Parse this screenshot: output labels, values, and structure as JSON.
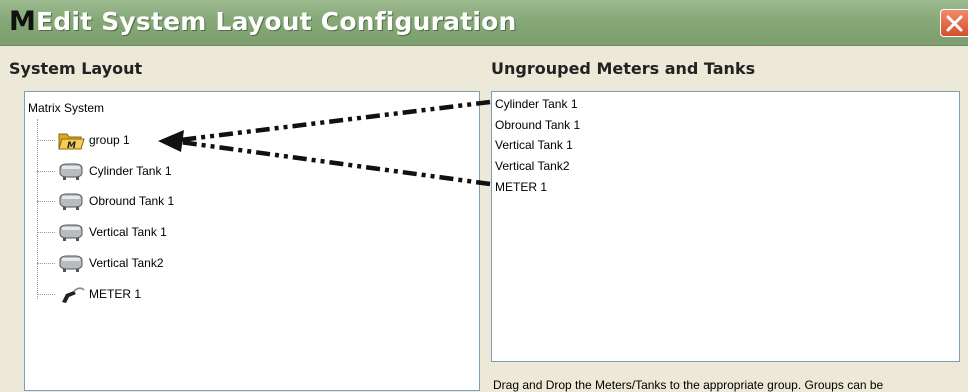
{
  "window": {
    "logo_letter": "M",
    "title": "Edit System Layout Configuration",
    "close_glyph": "close-icon"
  },
  "left_section": {
    "heading": "System Layout",
    "root_label": "Matrix System",
    "items": [
      {
        "label": "group 1",
        "icon": "group-folder-icon"
      },
      {
        "label": "Cylinder Tank 1",
        "icon": "tank-icon"
      },
      {
        "label": "Obround Tank 1",
        "icon": "tank-icon"
      },
      {
        "label": "Vertical Tank 1",
        "icon": "tank-icon"
      },
      {
        "label": "Vertical Tank2",
        "icon": "tank-icon"
      },
      {
        "label": "METER 1",
        "icon": "meter-nozzle-icon"
      }
    ]
  },
  "right_section": {
    "heading": "Ungrouped Meters and Tanks",
    "items": [
      "Cylinder Tank 1",
      "Obround Tank 1",
      "Vertical Tank 1",
      "Vertical Tank2",
      "METER 1"
    ],
    "hint": "Drag and Drop the Meters/Tanks to the appropriate group. Groups can be"
  },
  "colors": {
    "titlebar": "#86a877",
    "background": "#ece9d8",
    "close_button": "#d4502c",
    "folder": "#f2c94c"
  }
}
